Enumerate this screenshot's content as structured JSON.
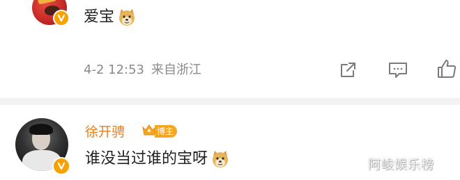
{
  "comment_1": {
    "text": "爱宝",
    "emoji_icon": "doge-icon",
    "time": "4-2 12:53",
    "location": "来自浙江",
    "actions": [
      "share-icon",
      "comment-icon",
      "like-icon"
    ]
  },
  "comment_2": {
    "username": "徐开骋",
    "badge_label": "博主",
    "text": "谁没当过谁的宝呀",
    "emoji_icon": "doge-icon"
  },
  "watermark": "阿峻娱乐榜",
  "colors": {
    "username": "#e87d1e",
    "badge": "#f5a623",
    "verified": "#f7a200",
    "meta_text": "#8a8a8a",
    "divider": "#f2f2f2"
  }
}
